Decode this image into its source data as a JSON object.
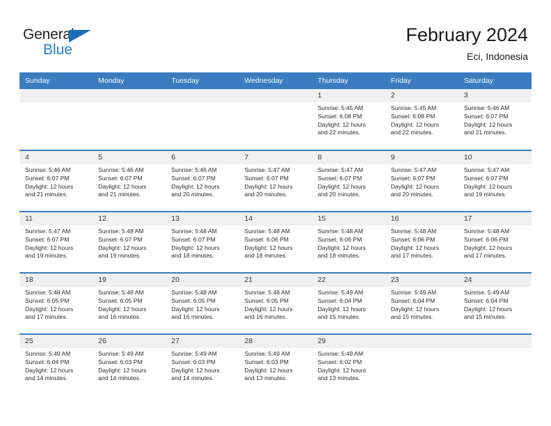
{
  "brand": {
    "name_top": "General",
    "name_bottom": "Blue",
    "accent_color": "#1a7fd4",
    "triangle_color": "#1a6fb5"
  },
  "header": {
    "title": "February 2024",
    "subtitle": "Eci, Indonesia",
    "header_bg": "#3a7cbf",
    "daynum_bg": "#f0f0f0"
  },
  "weekdays": [
    "Sunday",
    "Monday",
    "Tuesday",
    "Wednesday",
    "Thursday",
    "Friday",
    "Saturday"
  ],
  "weeks": [
    [
      {
        "day": "",
        "lines": []
      },
      {
        "day": "",
        "lines": []
      },
      {
        "day": "",
        "lines": []
      },
      {
        "day": "",
        "lines": []
      },
      {
        "day": "1",
        "lines": [
          "Sunrise: 5:45 AM",
          "Sunset: 6:08 PM",
          "Daylight: 12 hours",
          "and 22 minutes."
        ]
      },
      {
        "day": "2",
        "lines": [
          "Sunrise: 5:45 AM",
          "Sunset: 6:08 PM",
          "Daylight: 12 hours",
          "and 22 minutes."
        ]
      },
      {
        "day": "3",
        "lines": [
          "Sunrise: 5:46 AM",
          "Sunset: 6:07 PM",
          "Daylight: 12 hours",
          "and 21 minutes."
        ]
      }
    ],
    [
      {
        "day": "4",
        "lines": [
          "Sunrise: 5:46 AM",
          "Sunset: 6:07 PM",
          "Daylight: 12 hours",
          "and 21 minutes."
        ]
      },
      {
        "day": "5",
        "lines": [
          "Sunrise: 5:46 AM",
          "Sunset: 6:07 PM",
          "Daylight: 12 hours",
          "and 21 minutes."
        ]
      },
      {
        "day": "6",
        "lines": [
          "Sunrise: 5:46 AM",
          "Sunset: 6:07 PM",
          "Daylight: 12 hours",
          "and 20 minutes."
        ]
      },
      {
        "day": "7",
        "lines": [
          "Sunrise: 5:47 AM",
          "Sunset: 6:07 PM",
          "Daylight: 12 hours",
          "and 20 minutes."
        ]
      },
      {
        "day": "8",
        "lines": [
          "Sunrise: 5:47 AM",
          "Sunset: 6:07 PM",
          "Daylight: 12 hours",
          "and 20 minutes."
        ]
      },
      {
        "day": "9",
        "lines": [
          "Sunrise: 5:47 AM",
          "Sunset: 6:07 PM",
          "Daylight: 12 hours",
          "and 20 minutes."
        ]
      },
      {
        "day": "10",
        "lines": [
          "Sunrise: 5:47 AM",
          "Sunset: 6:07 PM",
          "Daylight: 12 hours",
          "and 19 minutes."
        ]
      }
    ],
    [
      {
        "day": "11",
        "lines": [
          "Sunrise: 5:47 AM",
          "Sunset: 6:07 PM",
          "Daylight: 12 hours",
          "and 19 minutes."
        ]
      },
      {
        "day": "12",
        "lines": [
          "Sunrise: 5:48 AM",
          "Sunset: 6:07 PM",
          "Daylight: 12 hours",
          "and 19 minutes."
        ]
      },
      {
        "day": "13",
        "lines": [
          "Sunrise: 5:48 AM",
          "Sunset: 6:07 PM",
          "Daylight: 12 hours",
          "and 18 minutes."
        ]
      },
      {
        "day": "14",
        "lines": [
          "Sunrise: 5:48 AM",
          "Sunset: 6:06 PM",
          "Daylight: 12 hours",
          "and 18 minutes."
        ]
      },
      {
        "day": "15",
        "lines": [
          "Sunrise: 5:48 AM",
          "Sunset: 6:06 PM",
          "Daylight: 12 hours",
          "and 18 minutes."
        ]
      },
      {
        "day": "16",
        "lines": [
          "Sunrise: 5:48 AM",
          "Sunset: 6:06 PM",
          "Daylight: 12 hours",
          "and 17 minutes."
        ]
      },
      {
        "day": "17",
        "lines": [
          "Sunrise: 5:48 AM",
          "Sunset: 6:06 PM",
          "Daylight: 12 hours",
          "and 17 minutes."
        ]
      }
    ],
    [
      {
        "day": "18",
        "lines": [
          "Sunrise: 5:48 AM",
          "Sunset: 6:05 PM",
          "Daylight: 12 hours",
          "and 17 minutes."
        ]
      },
      {
        "day": "19",
        "lines": [
          "Sunrise: 5:48 AM",
          "Sunset: 6:05 PM",
          "Daylight: 12 hours",
          "and 16 minutes."
        ]
      },
      {
        "day": "20",
        "lines": [
          "Sunrise: 5:48 AM",
          "Sunset: 6:05 PM",
          "Daylight: 12 hours",
          "and 16 minutes."
        ]
      },
      {
        "day": "21",
        "lines": [
          "Sunrise: 5:48 AM",
          "Sunset: 6:05 PM",
          "Daylight: 12 hours",
          "and 16 minutes."
        ]
      },
      {
        "day": "22",
        "lines": [
          "Sunrise: 5:49 AM",
          "Sunset: 6:04 PM",
          "Daylight: 12 hours",
          "and 15 minutes."
        ]
      },
      {
        "day": "23",
        "lines": [
          "Sunrise: 5:49 AM",
          "Sunset: 6:04 PM",
          "Daylight: 12 hours",
          "and 15 minutes."
        ]
      },
      {
        "day": "24",
        "lines": [
          "Sunrise: 5:49 AM",
          "Sunset: 6:04 PM",
          "Daylight: 12 hours",
          "and 15 minutes."
        ]
      }
    ],
    [
      {
        "day": "25",
        "lines": [
          "Sunrise: 5:49 AM",
          "Sunset: 6:04 PM",
          "Daylight: 12 hours",
          "and 14 minutes."
        ]
      },
      {
        "day": "26",
        "lines": [
          "Sunrise: 5:49 AM",
          "Sunset: 6:03 PM",
          "Daylight: 12 hours",
          "and 14 minutes."
        ]
      },
      {
        "day": "27",
        "lines": [
          "Sunrise: 5:49 AM",
          "Sunset: 6:03 PM",
          "Daylight: 12 hours",
          "and 14 minutes."
        ]
      },
      {
        "day": "28",
        "lines": [
          "Sunrise: 5:49 AM",
          "Sunset: 6:03 PM",
          "Daylight: 12 hours",
          "and 13 minutes."
        ]
      },
      {
        "day": "29",
        "lines": [
          "Sunrise: 5:49 AM",
          "Sunset: 6:02 PM",
          "Daylight: 12 hours",
          "and 13 minutes."
        ]
      },
      {
        "day": "",
        "lines": []
      },
      {
        "day": "",
        "lines": []
      }
    ]
  ]
}
